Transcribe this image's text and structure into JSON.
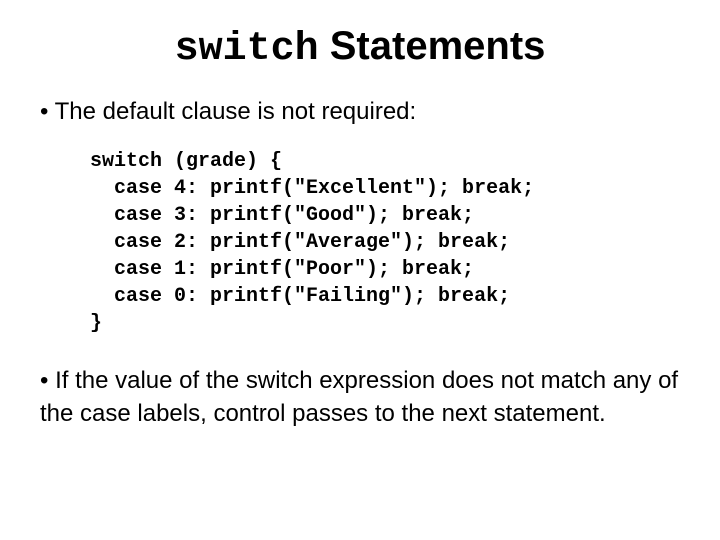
{
  "title": {
    "keyword": "switch",
    "rest": " Statements"
  },
  "bullet1": "• The default clause is not required:",
  "code": "switch (grade) {\n  case 4: printf(\"Excellent\"); break;\n  case 3: printf(\"Good\"); break;\n  case 2: printf(\"Average\"); break;\n  case 1: printf(\"Poor\"); break;\n  case 0: printf(\"Failing\"); break;\n}",
  "bullet2": "• If the value of the switch expression does not match any of the case labels, control passes to the next statement."
}
